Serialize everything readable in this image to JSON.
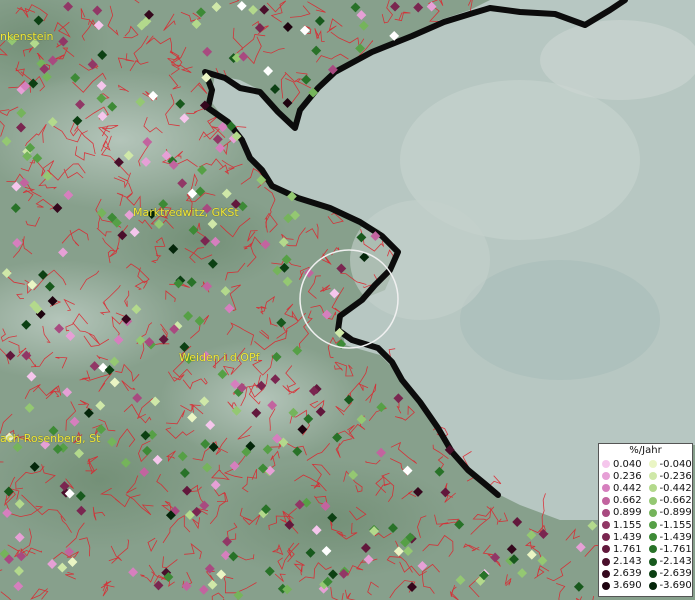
{
  "map": {
    "places": [
      {
        "label": "Marktredwitz, GKSt"
      },
      {
        "label": "Weiden i.d.OPf"
      },
      {
        "label": "ach-Rosenberg, St"
      },
      {
        "label": "nkenstein"
      }
    ]
  },
  "legend": {
    "title": "%/Jahr",
    "positive": [
      {
        "value": "0.040",
        "color": "#f5c6ec"
      },
      {
        "value": "0.236",
        "color": "#e6a0d6"
      },
      {
        "value": "0.442",
        "color": "#d67fbe"
      },
      {
        "value": "0.662",
        "color": "#c2649f"
      },
      {
        "value": "0.899",
        "color": "#a84a80"
      },
      {
        "value": "1.155",
        "color": "#913766"
      },
      {
        "value": "1.439",
        "color": "#7a2650"
      },
      {
        "value": "1.761",
        "color": "#62183c"
      },
      {
        "value": "2.143",
        "color": "#4a0f2b"
      },
      {
        "value": "2.639",
        "color": "#35081d"
      },
      {
        "value": "3.690",
        "color": "#1e030f"
      }
    ],
    "negative": [
      {
        "value": "-0.040",
        "color": "#eaf5c4"
      },
      {
        "value": "-0.236",
        "color": "#cfe8a8"
      },
      {
        "value": "-0.442",
        "color": "#b3d98c"
      },
      {
        "value": "-0.662",
        "color": "#94c872"
      },
      {
        "value": "-0.899",
        "color": "#75b45b"
      },
      {
        "value": "-1.155",
        "color": "#56a046"
      },
      {
        "value": "-1.439",
        "color": "#3d8a36"
      },
      {
        "value": "-1.761",
        "color": "#287228"
      },
      {
        "value": "-2.143",
        "color": "#18591d"
      },
      {
        "value": "-2.639",
        "color": "#0c4013"
      },
      {
        "value": "-3.690",
        "color": "#04260a"
      }
    ]
  }
}
